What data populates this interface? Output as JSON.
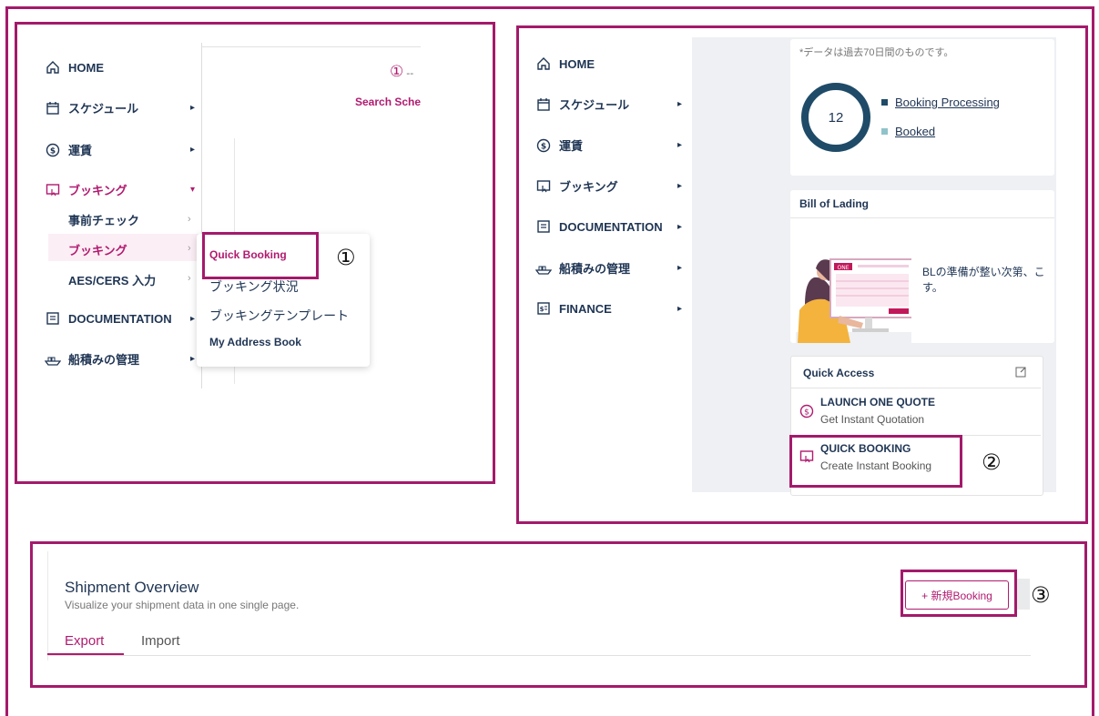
{
  "nav": {
    "home": "HOME",
    "schedule": "スケジュール",
    "rates": "運賃",
    "booking": "ブッキング",
    "documentation": "DOCUMENTATION",
    "shipment_mgmt": "船積みの管理",
    "finance": "FINANCE"
  },
  "panel1": {
    "submenu": [
      "事前チェック",
      "ブッキング",
      "AES/CERS 入力"
    ],
    "dropdown": [
      "Quick Booking",
      "ブッキング状況",
      "ブッキングテンプレート",
      "My Address Book"
    ],
    "step_indicator": "①",
    "step_dashes": "--",
    "search_schedule": "Search Sche",
    "marker": "①"
  },
  "panel2": {
    "data_note": "*データは過去70日間のものです。",
    "gauge_value": "12",
    "legend": [
      {
        "label": "Booking Processing",
        "color": "#1f4b68"
      },
      {
        "label": "Booked",
        "color": "#8fc3c9"
      }
    ],
    "bl_title": "Bill of Lading",
    "bl_text_1": "BLの準備が整い次第、こ",
    "bl_text_2": "す。",
    "bl_illustration_label": "ONE",
    "quick_access_title": "Quick Access",
    "qa_items": [
      {
        "title": "LAUNCH ONE QUOTE",
        "subtitle": "Get Instant Quotation"
      },
      {
        "title": "QUICK BOOKING",
        "subtitle": "Create Instant Booking"
      }
    ],
    "marker": "②"
  },
  "panel3": {
    "title": "Shipment Overview",
    "subtitle": "Visualize your shipment data in one single page.",
    "tabs": [
      "Export",
      "Import"
    ],
    "new_booking": "+ 新規Booking",
    "marker": "③"
  },
  "colors": {
    "accent": "#b11a6f",
    "navy": "#1f3554",
    "frame": "#a31a6b"
  }
}
